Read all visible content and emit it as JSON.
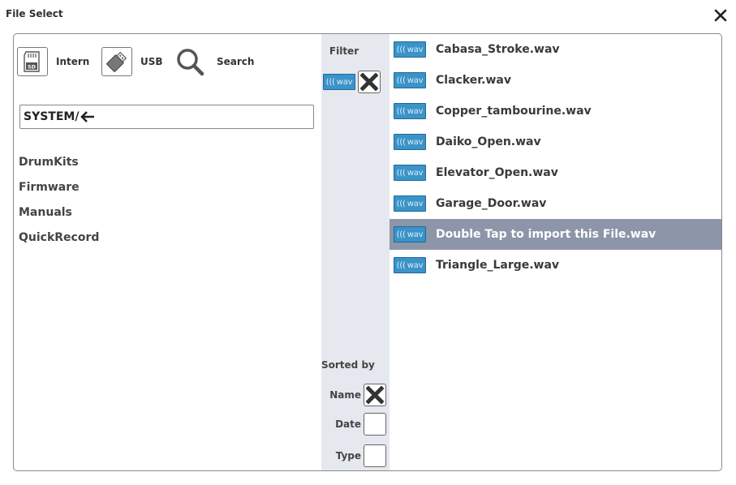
{
  "window": {
    "title": "File Select"
  },
  "sources": {
    "intern": {
      "label": "Intern",
      "icon": "sd-card-icon"
    },
    "usb": {
      "label": "USB",
      "icon": "usb-stick-icon"
    },
    "search": {
      "label": "Search",
      "icon": "search-icon"
    }
  },
  "path": {
    "value": "SYSTEM/"
  },
  "folders": [
    "DrumKits",
    "Firmware",
    "Manuals",
    "QuickRecord"
  ],
  "filter": {
    "label": "Filter",
    "tag": "wav",
    "checked": true
  },
  "sort": {
    "label": "Sorted by",
    "options": [
      {
        "label": "Name",
        "checked": true
      },
      {
        "label": "Date",
        "checked": false
      },
      {
        "label": "Type",
        "checked": false
      }
    ]
  },
  "files": [
    {
      "tag": "wav",
      "name": "Cabasa_Stroke.wav",
      "selected": false
    },
    {
      "tag": "wav",
      "name": "Clacker.wav",
      "selected": false
    },
    {
      "tag": "wav",
      "name": "Copper_tambourine.wav",
      "selected": false
    },
    {
      "tag": "wav",
      "name": "Daiko_Open.wav",
      "selected": false
    },
    {
      "tag": "wav",
      "name": "Elevator_Open.wav",
      "selected": false
    },
    {
      "tag": "wav",
      "name": "Garage_Door.wav",
      "selected": false
    },
    {
      "tag": "wav",
      "name": "Double Tap to import this File.wav",
      "selected": true
    },
    {
      "tag": "wav",
      "name": "Triangle_Large.wav",
      "selected": false
    }
  ],
  "colors": {
    "accent_wav": "#3b93c8",
    "selected_row": "#8d96a9",
    "filter_column": "#e6e8ef"
  }
}
